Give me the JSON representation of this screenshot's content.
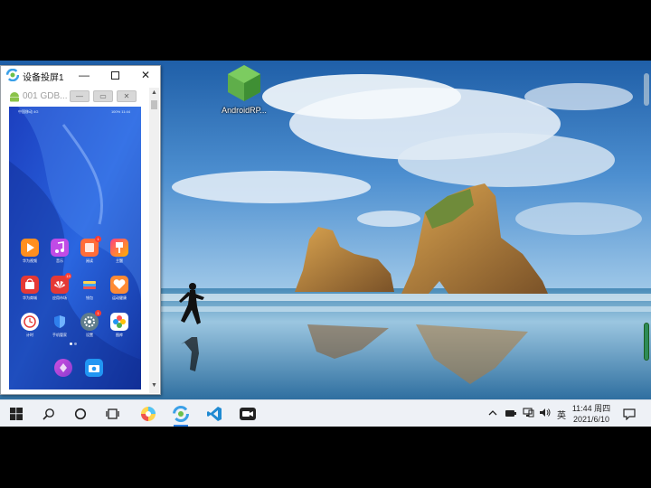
{
  "desktop": {
    "icon_label": "AndroidRP..."
  },
  "device_window": {
    "title": "设备投屏1",
    "device_name": "001",
    "device_id": "GDB...",
    "phone": {
      "status_carrier": "中国移动 4G",
      "status_right": "100% 11:44",
      "apps": [
        {
          "label": "华为视频",
          "color": "#ff8f1f",
          "icon": "play-icon"
        },
        {
          "label": "音乐",
          "color": "#c04be6",
          "icon": "music-icon"
        },
        {
          "label": "阅读",
          "color": "#ff6d3a",
          "icon": "book-icon",
          "badge": "1"
        },
        {
          "label": "主题",
          "color": "#ff4081",
          "icon": "brush-icon"
        },
        {
          "label": "华为商城",
          "color": "#e53935",
          "icon": "shop-icon"
        },
        {
          "label": "应用市场",
          "color": "#e53935",
          "icon": "huawei-icon",
          "badge": "13"
        },
        {
          "label": "钱包",
          "color": "#ffffff",
          "icon": "wallet-icon"
        },
        {
          "label": "运动健康",
          "color": "#ff8a34",
          "icon": "heart-icon"
        },
        {
          "label": "计时",
          "color": "#ffffff",
          "icon": "clock-icon"
        },
        {
          "label": "手机管家",
          "color": "#2f80ed",
          "icon": "shield-icon"
        },
        {
          "label": "设置",
          "color": "#607d8b",
          "icon": "gear-icon",
          "badge": "1"
        },
        {
          "label": "图库",
          "color": "#ffffff",
          "icon": "flower-icon"
        },
        {
          "label": "",
          "color": "#b040d8",
          "icon": "browser-icon"
        },
        {
          "label": "",
          "color": "#2196f3",
          "icon": "camera-icon"
        }
      ]
    }
  },
  "taskbar": {
    "input_method": "英",
    "time": "11:44 周四",
    "date": "2021/6/10"
  },
  "colors": {
    "taskbar_bg": "#eef1f6",
    "accent": "#2a7de1"
  }
}
